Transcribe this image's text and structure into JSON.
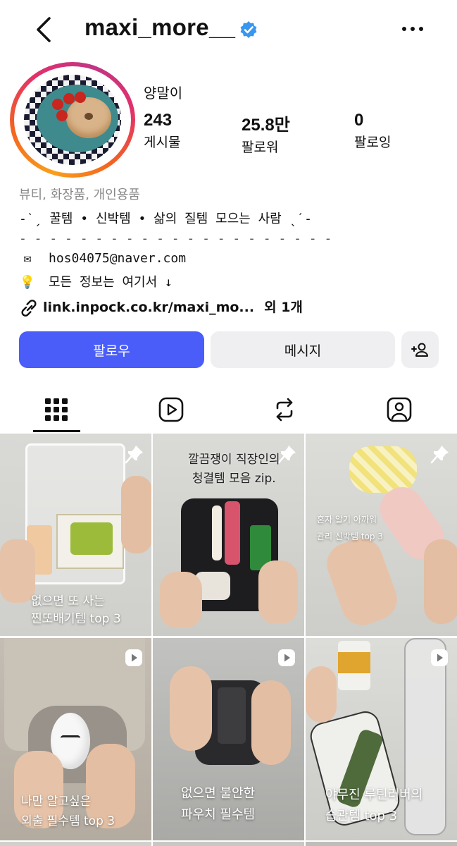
{
  "profile": {
    "username": "maxi_more__",
    "display_name": "양말이",
    "stats": [
      {
        "value": "243",
        "label": "게시물"
      },
      {
        "value": "25.8만",
        "label": "팔로워"
      },
      {
        "value": "0",
        "label": "팔로잉"
      }
    ],
    "category": "뷰티, 화장품, 개인용품",
    "bio_lines": [
      "-ˋˏ 꿀템 • 신박템 • 삶의 질템 모으는 사람 ˎˊ-",
      "- - - - - - - - - - - - - - - - - - - - -"
    ],
    "email": "hos04075@naver.com",
    "info_line": "모든 정보는 여기서 ↓",
    "link": "link.inpock.co.kr/maxi_mo...",
    "link_extra": "외 1개"
  },
  "buttons": {
    "follow": "팔로우",
    "message": "메시지"
  },
  "posts": [
    {
      "caption": [
        "없으면 또 사는",
        "찐또배기템 top 3"
      ],
      "type": "pinned"
    },
    {
      "caption": [
        "깔끔쟁이 직장인의",
        "청결템 모음 zip."
      ],
      "type": "pinned"
    },
    {
      "caption": [
        "혼자 알기 아까워",
        "관리 신박템 top 3"
      ],
      "type": "pinned"
    },
    {
      "caption": [
        "나만 알고싶은",
        "외출 필수템 top 3"
      ],
      "type": "reel"
    },
    {
      "caption": [
        "없으면 불안한",
        "파우치 필수템"
      ],
      "type": "reel"
    },
    {
      "caption": [
        "야무진 루틴러버의",
        "습관템 top 3"
      ],
      "type": "reel"
    }
  ],
  "colors": {
    "follow_button": "#4a5df9",
    "secondary_button": "#efeff1",
    "verified_badge": "#3897f0",
    "category_text": "#888888"
  },
  "icons": {
    "back": "chevron-left-icon",
    "verified": "verified-badge-icon",
    "more": "more-horizontal-icon",
    "email": "envelope-emoji-icon",
    "info": "lightbulb-emoji-icon",
    "link": "link-chain-icon",
    "add_person": "add-person-icon",
    "tabs": [
      "grid-icon",
      "reels-icon",
      "reposts-icon",
      "tagged-icon"
    ],
    "pin": "pin-icon",
    "reel": "reel-icon"
  }
}
